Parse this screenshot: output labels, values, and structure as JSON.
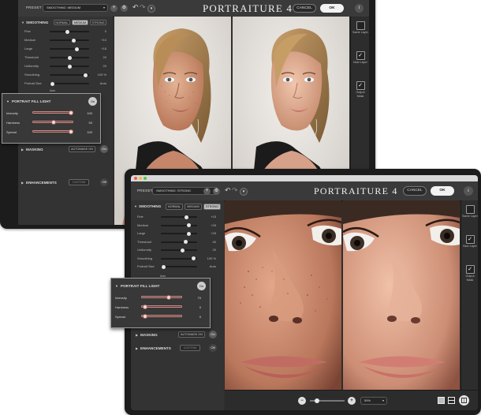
{
  "back_window": {
    "toolbar": {
      "preset_label": "PRESET",
      "preset_value": "SMOOTHING: MEDIUM",
      "add_symbol": "+",
      "gear_symbol": "⚙",
      "title": "PORTRAITURE 4",
      "cancel_label": "CANCEL",
      "ok_label": "OK",
      "info_symbol": "i"
    },
    "smoothing": {
      "header": "SMOOTHING",
      "segments": [
        "NORMAL",
        "MEDIUM",
        "STRONG"
      ],
      "selected": "MEDIUM",
      "sliders": [
        {
          "label": "Fine",
          "value": "0",
          "pos": 0.45
        },
        {
          "label": "Medium",
          "value": "+10",
          "pos": 0.62
        },
        {
          "label": "Large",
          "value": "+18",
          "pos": 0.72
        },
        {
          "label": "Threshold",
          "value": "20",
          "pos": 0.5
        },
        {
          "label": "Uniformity",
          "value": "20",
          "pos": 0.5
        },
        {
          "label": "Smoothing",
          "value": "100 %",
          "pos": 0.95
        },
        {
          "label": "Portrait Size",
          "value": "Auto",
          "pos": 0.02
        }
      ],
      "auto_label": "Auto"
    },
    "fill_light": {
      "header": "PORTRAIT FILL LIGHT",
      "toggle": "On",
      "sliders": [
        {
          "label": "Intensity",
          "value": "100",
          "pos": 0.98
        },
        {
          "label": "Hardness",
          "value": "50",
          "pos": 0.5
        },
        {
          "label": "Spread",
          "value": "100",
          "pos": 0.98
        }
      ]
    },
    "masking": {
      "header": "MASKING",
      "mode": "AUTOMASK ON",
      "toggle": "On"
    },
    "enhancements": {
      "header": "ENHANCEMENTS",
      "mode": "CUSTOM",
      "toggle": "Off"
    },
    "right_strip": [
      {
        "label": "Same Layer",
        "checked": false
      },
      {
        "label": "New Layer",
        "checked": true
      },
      {
        "label": "Output Mask",
        "checked": true
      }
    ]
  },
  "front_window": {
    "toolbar": {
      "preset_label": "PRESET",
      "preset_value": "SMOOTHING: STRONG",
      "add_symbol": "+",
      "gear_symbol": "⚙",
      "title": "PORTRAITURE 4",
      "cancel_label": "CANCEL",
      "ok_label": "OK",
      "info_symbol": "i"
    },
    "smoothing": {
      "header": "SMOOTHING",
      "segments": [
        "NORMAL",
        "MEDIUM",
        "STRONG"
      ],
      "selected": "STRONG",
      "sliders": [
        {
          "label": "Fine",
          "value": "+15",
          "pos": 0.72
        },
        {
          "label": "Medium",
          "value": "+25",
          "pos": 0.8
        },
        {
          "label": "Large",
          "value": "+25",
          "pos": 0.8
        },
        {
          "label": "Threshold",
          "value": "40",
          "pos": 0.7
        },
        {
          "label": "Uniformity",
          "value": "20",
          "pos": 0.62
        },
        {
          "label": "Smoothing",
          "value": "100 %",
          "pos": 0.95
        },
        {
          "label": "Portrait Size",
          "value": "Auto",
          "pos": 0.02
        }
      ],
      "auto_label": "Auto"
    },
    "fill_light": {
      "header": "PORTRAIT FILL LIGHT",
      "toggle": "On",
      "sliders": [
        {
          "label": "Intensity",
          "value": "70",
          "pos": 0.68
        },
        {
          "label": "Hardness",
          "value": "0",
          "pos": 0.02
        },
        {
          "label": "Spread",
          "value": "0",
          "pos": 0.02
        }
      ]
    },
    "masking": {
      "header": "MASKING",
      "mode": "AUTOMASK ON",
      "toggle": "On"
    },
    "enhancements": {
      "header": "ENHANCEMENTS",
      "mode": "CUSTOM",
      "toggle": "Off"
    },
    "right_strip": [
      {
        "label": "Same Layer",
        "checked": false
      },
      {
        "label": "New Layer",
        "checked": true
      },
      {
        "label": "Output Mask",
        "checked": true
      }
    ],
    "bottom_bar": {
      "zoom_out": "−",
      "zoom_in": "+",
      "zoom_value": "59%",
      "zoom_fraction": 0.15
    }
  },
  "colors": {
    "window_bg": "#2e2e2e",
    "toolbar_bg": "#3a3a3a",
    "fill_light_track": "#c98a86",
    "ok_button": "#f2f2f2"
  }
}
